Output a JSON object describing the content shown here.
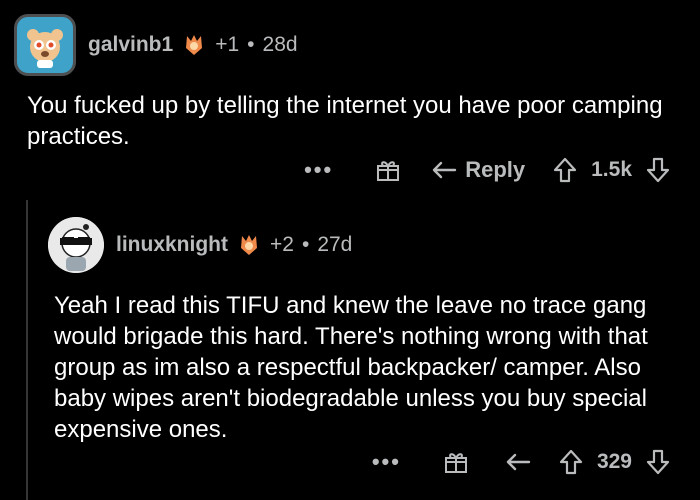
{
  "comments": [
    {
      "username": "galvinb1",
      "award_count": "+1",
      "age": "28d",
      "separator": "•",
      "body": "You fucked up by telling the internet you have poor camping practices.",
      "actions": {
        "more_label": "•••",
        "reply_label": "Reply",
        "score": "1.5k"
      }
    },
    {
      "username": "linuxknight",
      "award_count": "+2",
      "age": "27d",
      "separator": "•",
      "body": "Yeah I read this TIFU and knew the leave no trace gang would brigade this hard.  There's nothing wrong with that group as im also a respectful backpacker/ camper.  Also baby wipes aren't biodegradable unless you buy special expensive ones.",
      "actions": {
        "more_label": "•••",
        "score": "329"
      }
    }
  ],
  "icons": [
    "award-flair-icon",
    "gift-icon",
    "reply-arrow-icon",
    "upvote-icon",
    "downvote-icon"
  ],
  "colors": {
    "background": "#000000",
    "text": "#ffffff",
    "muted": "#b9bbbd",
    "thread": "#343536"
  }
}
